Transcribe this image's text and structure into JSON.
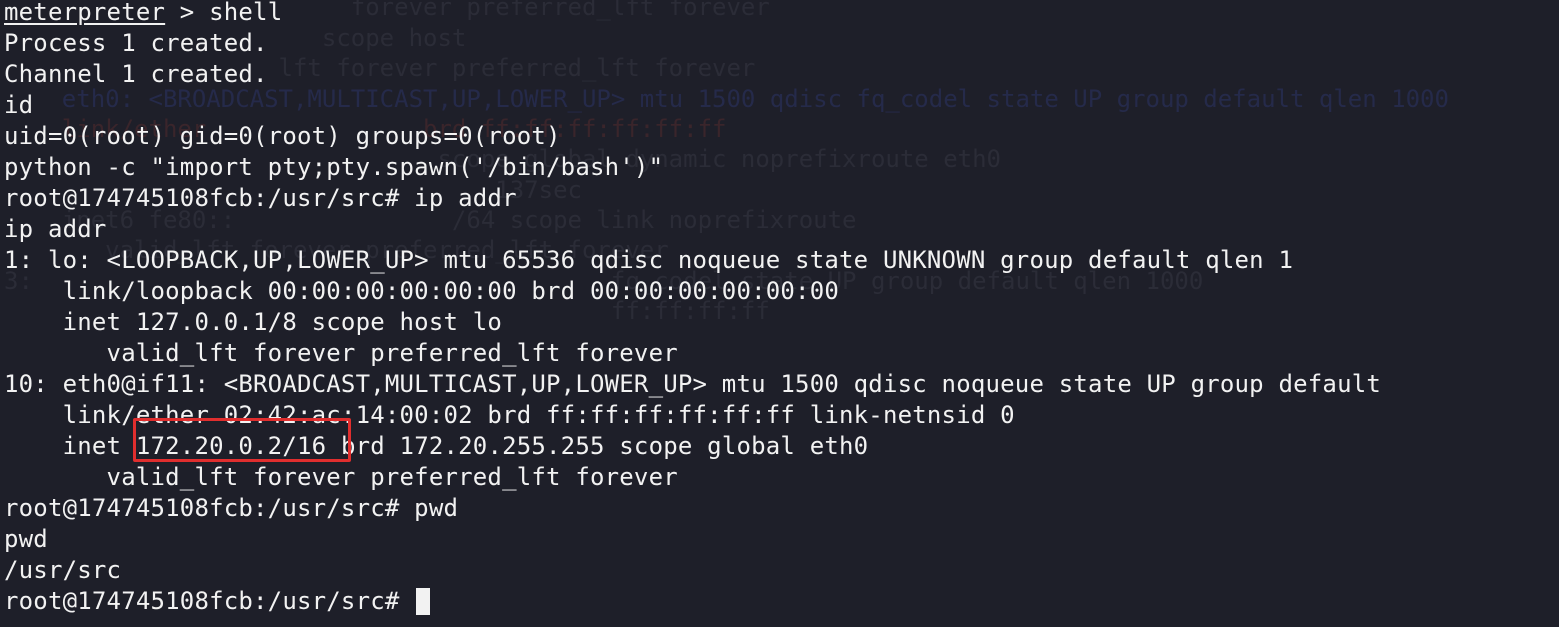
{
  "background_color": "#1e1f29",
  "text_color": "#f2f2f2",
  "highlight_color": "#e02e2e",
  "cursor": {
    "icon": "block-cursor-icon"
  },
  "ghost_lines": [
    "                        forever preferred_lft forever",
    "                      scope host",
    "                   lft forever preferred_lft forever",
    "    eth0: <BROADCAST,MULTICAST,UP,LOWER_UP> mtu 1500 qdisc fq_codel state UP group default qlen 1000",
    "    link/ether               brd ff:ff:ff:ff:ff:ff",
    "                              scope global dynamic noprefixroute eth0",
    "                                  137sec",
    "    inet6 fe80::               /64 scope link noprefixroute",
    "       valid_lft forever preferred_lft forever",
    "3:                                        fq_codel state UP group default qlen 1000",
    "                                          ff:ff:ff:ff"
  ],
  "terminal": {
    "line1_prompt": "meterpreter",
    "line1_cmd": " > shell",
    "line2": "Process 1 created.",
    "line3": "Channel 1 created.",
    "line4": "id",
    "line5": "uid=0(root) gid=0(root) groups=0(root)",
    "line6": "python -c \"import pty;pty.spawn('/bin/bash')\"",
    "line7": "root@174745108fcb:/usr/src# ip addr",
    "line8": "ip addr",
    "line9": "1: lo: <LOOPBACK,UP,LOWER_UP> mtu 65536 qdisc noqueue state UNKNOWN group default qlen 1",
    "line10": "    link/loopback 00:00:00:00:00:00 brd 00:00:00:00:00:00",
    "line11": "    inet 127.0.0.1/8 scope host lo",
    "line12": "       valid_lft forever preferred_lft forever",
    "line13": "10: eth0@if11: <BROADCAST,MULTICAST,UP,LOWER_UP> mtu 1500 qdisc noqueue state UP group default",
    "line14": "    link/ether 02:42:ac:14:00:02 brd ff:ff:ff:ff:ff:ff link-netnsid 0",
    "line15_pre": "    inet ",
    "line15_ip": "172.20.0.2/16",
    "line15_post": " brd 172.20.255.255 scope global eth0",
    "line16": "       valid_lft forever preferred_lft forever",
    "line17": "root@174745108fcb:/usr/src# pwd",
    "line18": "pwd",
    "line19": "/usr/src",
    "line20_prompt": "root@174745108fcb:/usr/src# "
  }
}
